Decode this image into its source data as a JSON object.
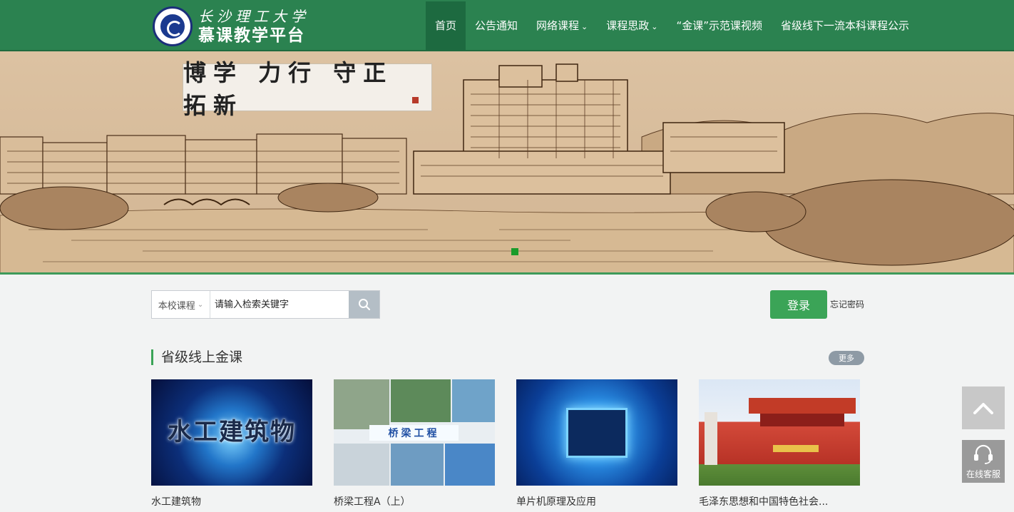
{
  "header": {
    "logo_cn": "长沙理工大学",
    "logo_sub": "慕课教学平台",
    "nav": [
      {
        "label": "首页",
        "dropdown": false,
        "active": true
      },
      {
        "label": "公告通知",
        "dropdown": false,
        "active": false
      },
      {
        "label": "网络课程",
        "dropdown": true,
        "active": false
      },
      {
        "label": "课程思政",
        "dropdown": true,
        "active": false
      },
      {
        "label": "“金课”示范课视频",
        "dropdown": false,
        "active": false
      },
      {
        "label": "省级线下一流本科课程公示",
        "dropdown": false,
        "active": false
      }
    ]
  },
  "banner": {
    "motto": "博学 力行 守正 拓新",
    "slides": 1,
    "active_slide": 1
  },
  "search": {
    "scope": "本校课程",
    "placeholder": "请输入检索关键字"
  },
  "auth": {
    "login_label": "登录",
    "forgot_label": "忘记密码"
  },
  "section": {
    "title": "省级线上金课",
    "more_label": "更多",
    "courses": [
      {
        "title": "水工建筑物",
        "thumb_text": "水工建筑物"
      },
      {
        "title": "桥梁工程A（上）",
        "thumb_text": "桥梁工程"
      },
      {
        "title": "单片机原理及应用",
        "thumb_text": ""
      },
      {
        "title": "毛泽东思想和中国特色社会...",
        "thumb_text": ""
      }
    ]
  },
  "sidebar": {
    "service_label": "在线客服"
  },
  "colors": {
    "header_green": "#2b8250",
    "nav_active": "#1d6a40",
    "accent_green": "#3ba457",
    "page_bg": "#f2f3f3"
  }
}
